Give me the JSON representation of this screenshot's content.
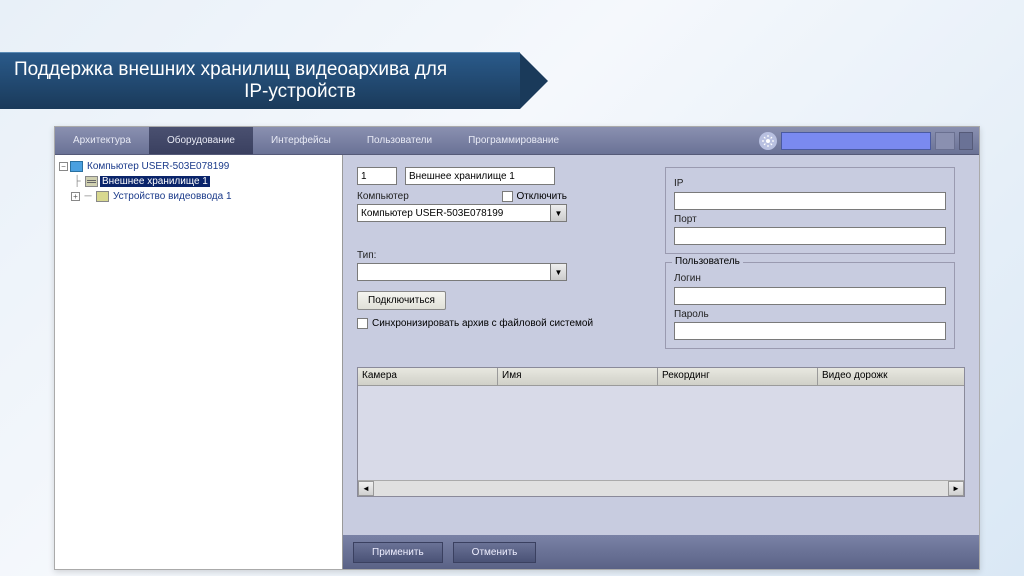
{
  "slide": {
    "line1": "Поддержка внешних хранилищ видеоархива для",
    "line2": "IP-устройств"
  },
  "tabs": {
    "arch": "Архитектура",
    "equip": "Оборудование",
    "interfaces": "Интерфейсы",
    "users": "Пользователи",
    "programming": "Программирование"
  },
  "tree": {
    "computer": "Компьютер USER-503E078199",
    "storage": "Внешнее хранилище 1",
    "video": "Устройство видеоввода 1"
  },
  "form": {
    "id": "1",
    "name": "Внешнее хранилище 1",
    "computer_label": "Компьютер",
    "disable_label": "Отключить",
    "computer_value": "Компьютер USER-503E078199",
    "type_label": "Тип:",
    "type_value": "",
    "connect_btn": "Подключиться",
    "sync_label": "Синхронизировать архив с файловой системой",
    "ip_label": "IP",
    "ip_value": "",
    "port_label": "Порт",
    "port_value": "",
    "user_legend": "Пользователь",
    "login_label": "Логин",
    "login_value": "",
    "password_label": "Пароль",
    "password_value": ""
  },
  "grid": {
    "camera": "Камера",
    "name": "Имя",
    "recording": "Рекординг",
    "track": "Видео дорожк"
  },
  "buttons": {
    "apply": "Применить",
    "cancel": "Отменить"
  }
}
